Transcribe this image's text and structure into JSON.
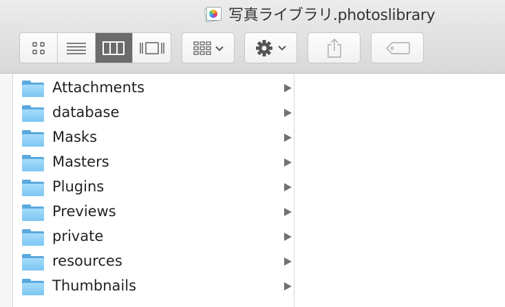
{
  "window": {
    "title": "写真ライブラリ.photoslibrary"
  },
  "toolbar": {
    "view_modes": [
      {
        "name": "icon-view",
        "icon": "grid-icon",
        "active": false
      },
      {
        "name": "list-view",
        "icon": "list-icon",
        "active": false
      },
      {
        "name": "column-view",
        "icon": "columns-icon",
        "active": true
      },
      {
        "name": "cover-flow-view",
        "icon": "cover-flow-icon",
        "active": false
      }
    ],
    "arrange_icon": "arrange-icon",
    "action_icon": "gear-icon",
    "share_icon": "share-icon",
    "tag_icon": "tag-icon"
  },
  "folders": [
    {
      "name": "Attachments"
    },
    {
      "name": "database"
    },
    {
      "name": "Masks"
    },
    {
      "name": "Masters"
    },
    {
      "name": "Plugins"
    },
    {
      "name": "Previews"
    },
    {
      "name": "private"
    },
    {
      "name": "resources"
    },
    {
      "name": "Thumbnails"
    }
  ],
  "colors": {
    "folder_front": "#7cc6f2",
    "folder_back": "#5aa9dd",
    "active_segment": "#6b6b6b"
  }
}
